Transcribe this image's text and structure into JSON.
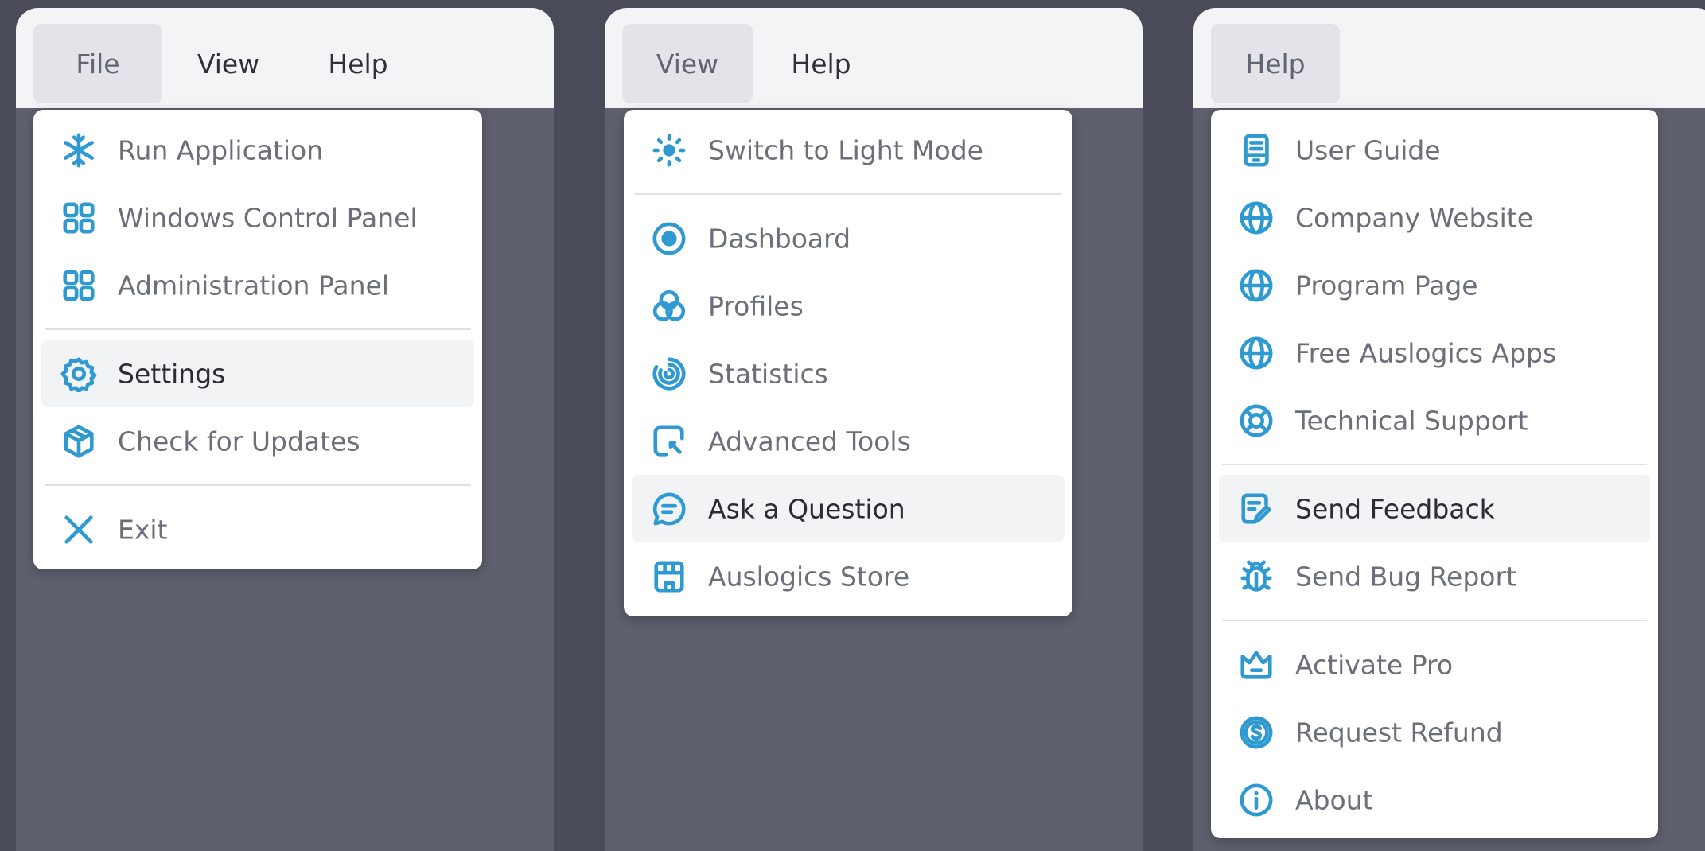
{
  "colors": {
    "accent": "#2f9ad2",
    "background": "#4a4b58",
    "panel": "#5e606e",
    "menubar": "#f3f4f6",
    "dropdown": "#ffffff",
    "highlight": "#f2f3f5"
  },
  "menu1": {
    "bar": [
      "File",
      "View",
      "Help"
    ],
    "items": [
      {
        "label": "Run Application",
        "icon": "snowflake-icon"
      },
      {
        "label": "Windows Control Panel",
        "icon": "grid-icon"
      },
      {
        "label": "Administration Panel",
        "icon": "grid-icon"
      },
      {
        "label": "Settings",
        "icon": "gear-icon"
      },
      {
        "label": "Check for Updates",
        "icon": "box-icon"
      },
      {
        "label": "Exit",
        "icon": "close-icon"
      }
    ]
  },
  "menu2": {
    "bar": [
      "View",
      "Help"
    ],
    "items": [
      {
        "label": "Switch to Light Mode",
        "icon": "sun-icon"
      },
      {
        "label": "Dashboard",
        "icon": "dashboard-icon"
      },
      {
        "label": "Profiles",
        "icon": "profiles-icon"
      },
      {
        "label": "Statistics",
        "icon": "statistics-icon"
      },
      {
        "label": "Advanced Tools",
        "icon": "advanced-tools-icon"
      },
      {
        "label": "Ask a Question",
        "icon": "chat-icon"
      },
      {
        "label": "Auslogics Store",
        "icon": "store-icon"
      }
    ]
  },
  "menu3": {
    "bar": [
      "Help"
    ],
    "items": [
      {
        "label": "User Guide",
        "icon": "guide-icon"
      },
      {
        "label": "Company Website",
        "icon": "globe-icon"
      },
      {
        "label": "Program Page",
        "icon": "globe-icon"
      },
      {
        "label": "Free Auslogics Apps",
        "icon": "globe-icon"
      },
      {
        "label": "Technical Support",
        "icon": "lifebuoy-icon"
      },
      {
        "label": "Send Feedback",
        "icon": "feedback-icon"
      },
      {
        "label": "Send Bug Report",
        "icon": "bug-icon"
      },
      {
        "label": "Activate Pro",
        "icon": "crown-icon"
      },
      {
        "label": "Request Refund",
        "icon": "dollar-icon"
      },
      {
        "label": "About",
        "icon": "info-icon"
      }
    ]
  }
}
